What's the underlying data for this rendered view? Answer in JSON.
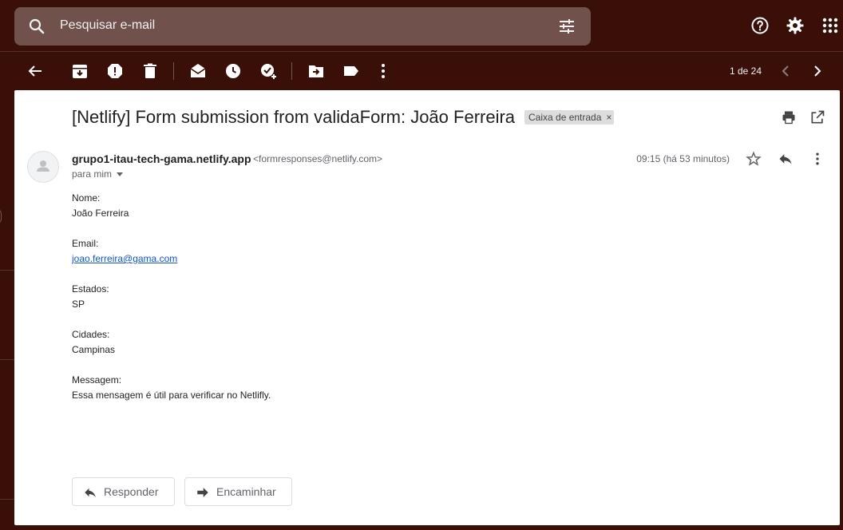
{
  "header": {
    "search_placeholder": "Pesquisar e-mail",
    "icons": [
      "search-icon",
      "tune-icon",
      "help-icon",
      "settings-icon",
      "apps-icon"
    ]
  },
  "toolbar": {
    "icons": [
      "back-arrow-icon",
      "archive-icon",
      "report-spam-icon",
      "delete-icon",
      "mark-unread-icon",
      "snooze-icon",
      "add-task-icon",
      "move-to-icon",
      "label-icon",
      "more-icon"
    ],
    "pager": "1 de 24"
  },
  "message": {
    "subject": "[Netlify] Form submission from validaForm: João Ferreira",
    "label": "Caixa de entrada",
    "label_remove": "×",
    "sender_name": "grupo1-itau-tech-gama.netlify.app",
    "sender_email": "<formresponses@netlify.com>",
    "recipient": "para mim",
    "time": "09:15 (há 53 minutos)",
    "fields": [
      {
        "label": "Nome:",
        "value": "João Ferreira"
      },
      {
        "label": "Email:",
        "value": "joao.ferreira@gama.com"
      },
      {
        "label": "Estados:",
        "value": "SP"
      },
      {
        "label": "Cidades:",
        "value": "Campinas"
      },
      {
        "label": "Messagem:",
        "value": "Essa mensagem é útil para verificar no Netlifly."
      }
    ]
  },
  "actions": {
    "reply": "Responder",
    "forward": "Encaminhar"
  },
  "colors": {
    "theme_background": "#3a0f08",
    "panel": "#ffffff",
    "link": "#1155cc"
  }
}
